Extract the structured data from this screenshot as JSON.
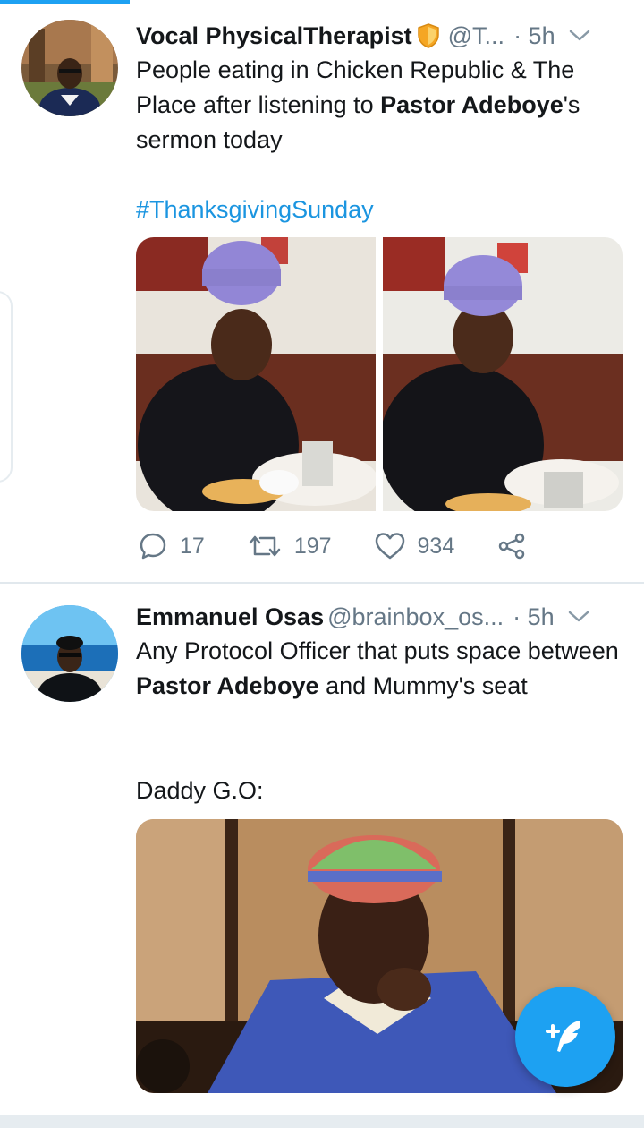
{
  "tweets": [
    {
      "name": "Vocal PhysicalTherapist",
      "handle": "@T...",
      "time": "· 5h",
      "text_1": "People eating in Chicken Republic & The Place after listening to ",
      "text_bold_1": "Pastor Adeboye",
      "text_2": "'s sermon today",
      "hashtag": "#ThanksgivingSunday",
      "replies": "17",
      "retweets": "197",
      "likes": "934"
    },
    {
      "name": "Emmanuel Osas",
      "handle": "@brainbox_os...",
      "time": "· 5h",
      "text_1": "Any Protocol Officer that puts space between ",
      "text_bold_1": "Pastor Adeboye",
      "text_2": " and Mummy's seat",
      "text_3": "Daddy G.O:"
    }
  ],
  "colors": {
    "accent": "#1da1f2",
    "hashtag": "#1b95e0",
    "secondary_text": "#657786",
    "verified_badge": "#f5a623"
  }
}
